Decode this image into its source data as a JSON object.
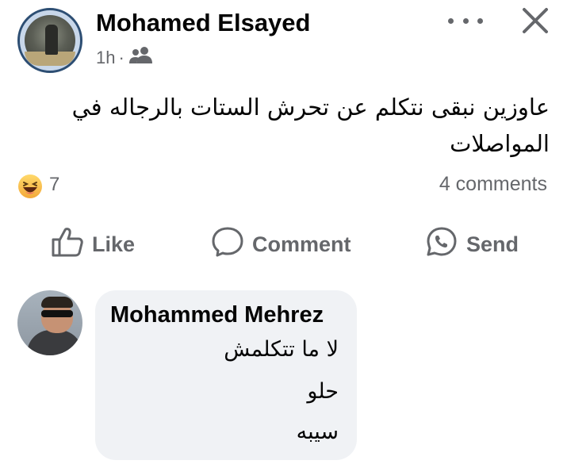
{
  "post": {
    "author_name": "Mohamed Elsayed",
    "time": "1h",
    "separator": "·",
    "audience_icon": "friends-icon",
    "text": "عاوزين نبقى نتكلم عن تحرش الستات بالرجاله في المواصلات"
  },
  "reactions": {
    "emoji": "laughing-face",
    "count": "7",
    "comments": "4 comments"
  },
  "actions": {
    "like_label": "Like",
    "comment_label": "Comment",
    "send_label": "Send"
  },
  "comment": {
    "author_name": "Mohammed Mehrez",
    "lines": [
      "لا ما تتكلمش",
      "حلو",
      "سيبه"
    ]
  },
  "colors": {
    "text": "#050505",
    "secondary": "#65676b",
    "bubble": "#f0f2f5",
    "avatar_ring": "#2d4e73"
  }
}
